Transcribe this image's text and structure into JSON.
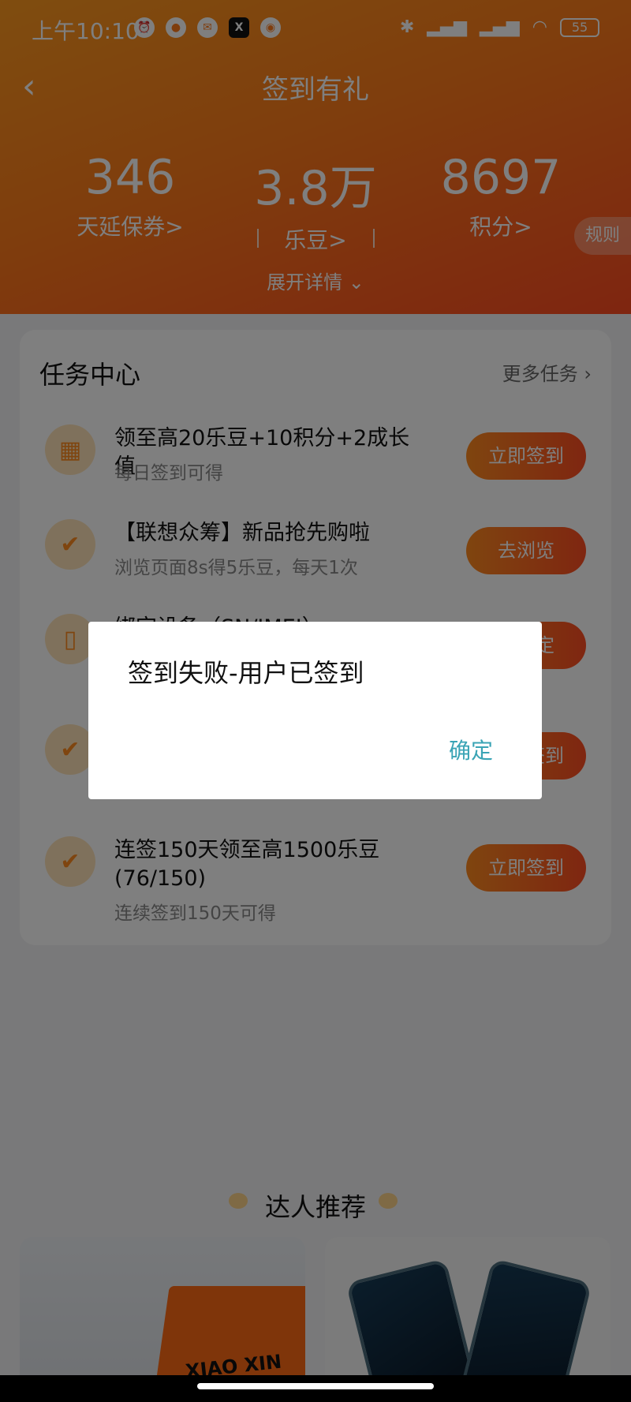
{
  "status_bar": {
    "time": "上午10:10",
    "battery": "55"
  },
  "nav": {
    "back": "‹",
    "title": "签到有礼"
  },
  "stats": [
    {
      "value": "346",
      "label": "天延保券>"
    },
    {
      "value": "3.8万",
      "label": "乐豆>"
    },
    {
      "value": "8697",
      "label": "积分>"
    }
  ],
  "rules_label": "规则",
  "expand_label": "展开详情 ⌄",
  "task_center": {
    "title": "任务中心",
    "more": "更多任务 ›",
    "tasks": [
      {
        "icon": "calendar-icon",
        "title": "领至高20乐豆+10积分+2成长值",
        "desc": "每日签到可得",
        "button": "立即签到"
      },
      {
        "icon": "badge-check-icon",
        "title": "【联想众筹】新品抢先购啦",
        "desc": "浏览页面8s得5乐豆，每天1次",
        "button": "去浏览"
      },
      {
        "icon": "phone-icon",
        "title": "绑定设备（SN/IMEI）",
        "desc": "",
        "button": "去绑定"
      },
      {
        "icon": "badge-check-icon",
        "title": "",
        "desc": "",
        "button": "立即签到"
      },
      {
        "icon": "badge-check-icon",
        "title": "连签150天领至高1500乐豆 (76/150)",
        "desc": "连续签到150天可得",
        "button": "立即签到"
      }
    ]
  },
  "recommend": {
    "title": "达人推荐",
    "laptop_brand": "XIAO XIN"
  },
  "dialog": {
    "message": "签到失败-用户已签到",
    "confirm": "确定"
  }
}
